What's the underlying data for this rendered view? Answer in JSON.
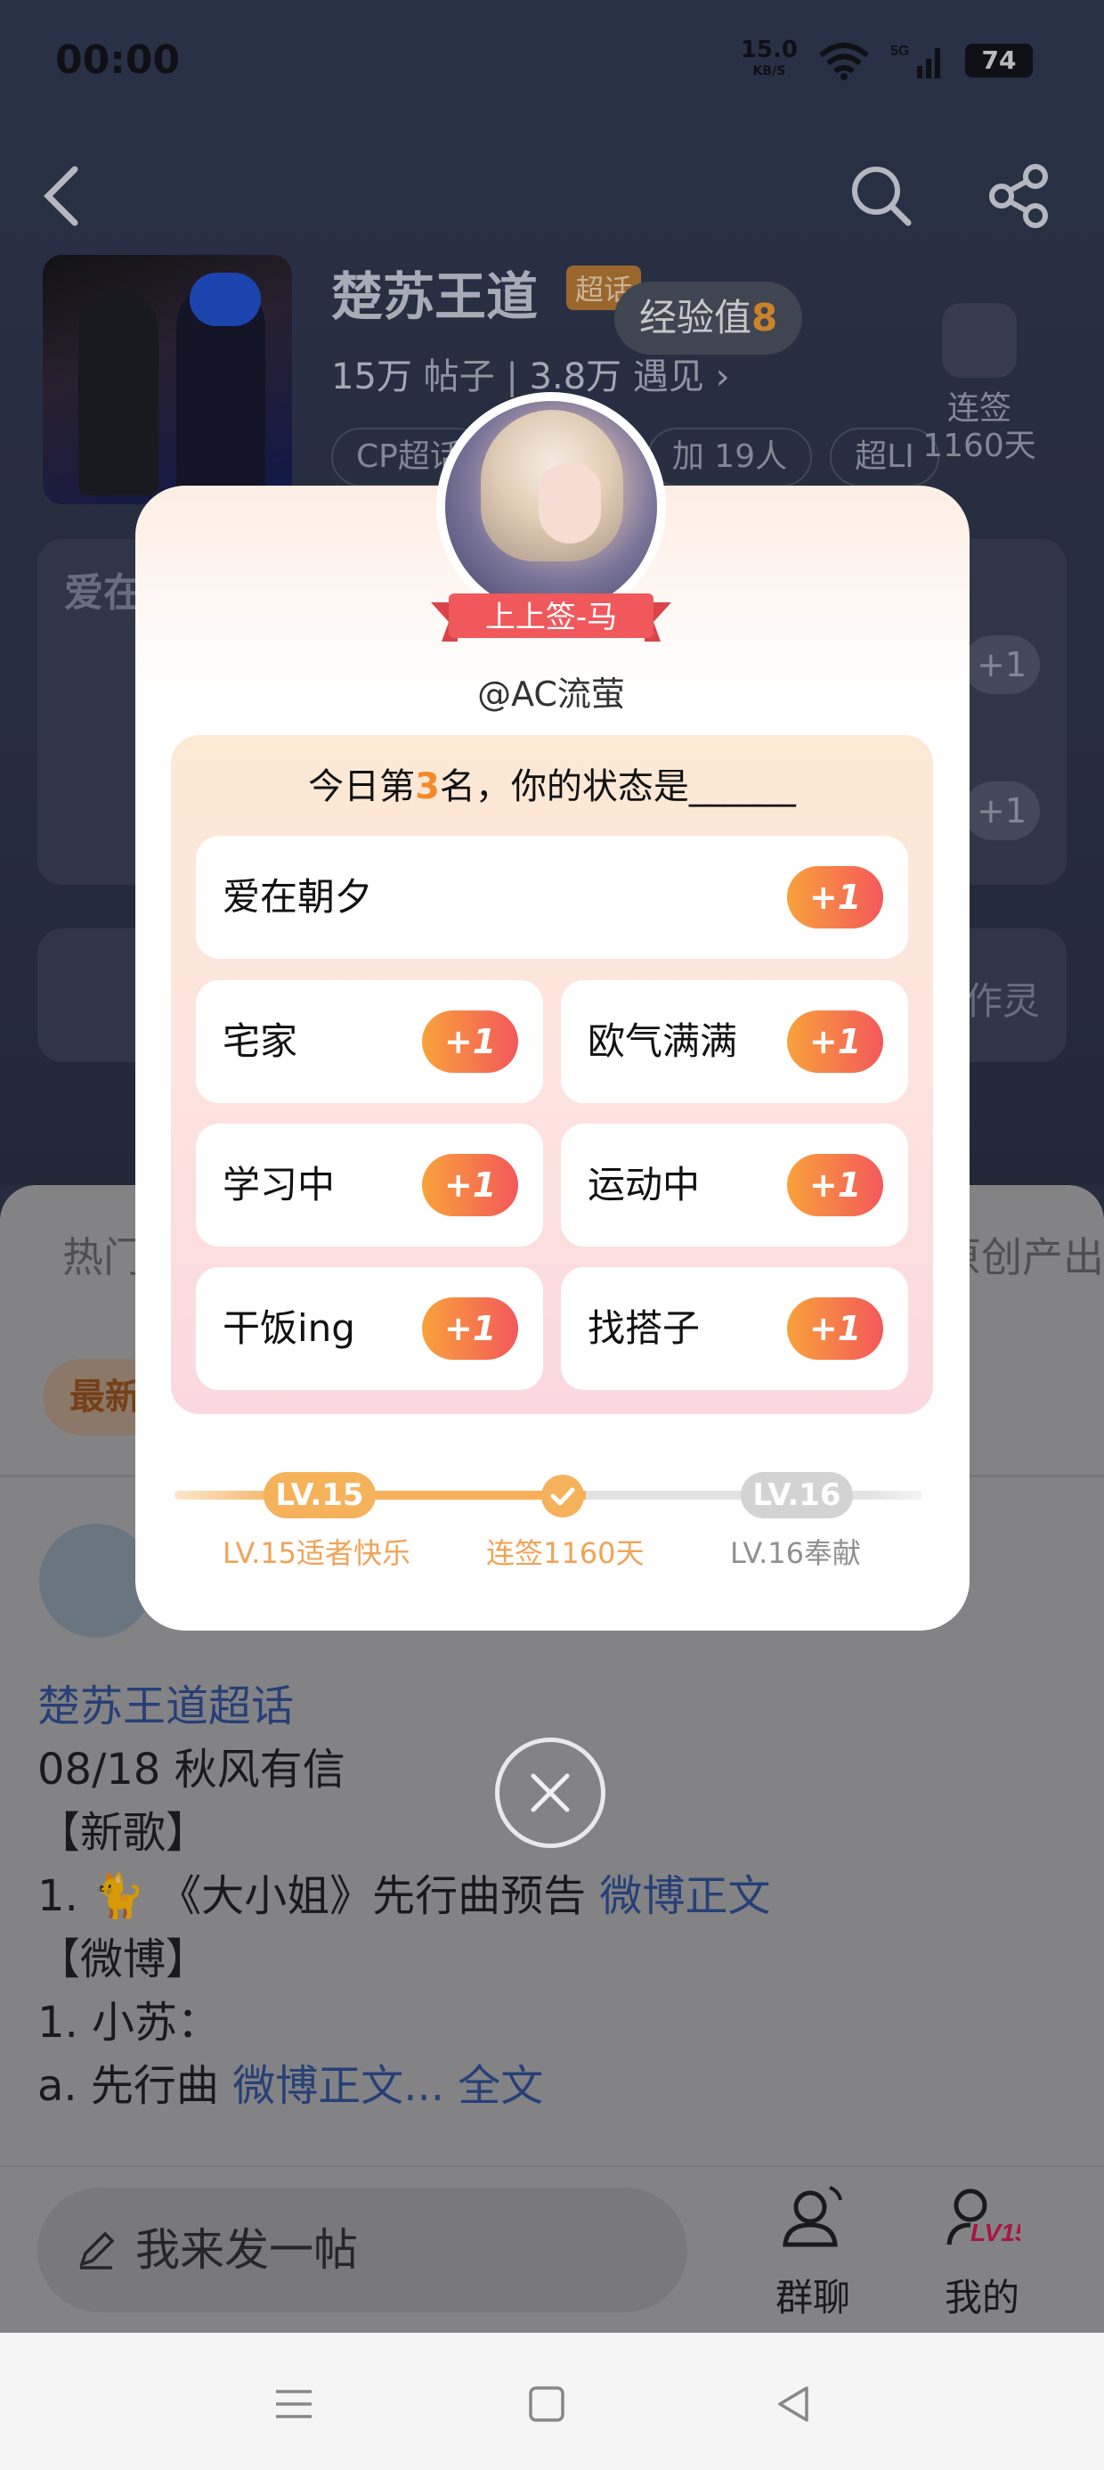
{
  "status_bar": {
    "time": "00:00",
    "speed_value": "15.0",
    "speed_unit": "KB/S",
    "battery": "74",
    "net": "5G"
  },
  "topic": {
    "title": "楚苏王道",
    "badge": "超话",
    "posts_count": "15万",
    "posts_label": "帖子",
    "meet_count": "3.8万",
    "meet_label": "遇见",
    "tags": [
      "CP超话",
      "加 19人",
      "超LI"
    ],
    "signin_label": "连签",
    "signin_days": "1160天"
  },
  "exp": {
    "label": "经验值",
    "value": "8"
  },
  "bg_cards": {
    "card_title": "爱在",
    "plus": "+1",
    "creator_text": "创作灵"
  },
  "lower": {
    "tab_left": "热门",
    "tab_right": "原创产出",
    "newest": "最新",
    "post_lines": {
      "topic_link": "楚苏王道超话",
      "l1": "08/18 秋风有信",
      "l2": "【新歌】",
      "l3_prefix": "1. 🐈 《大小姐》先行曲预告 ",
      "l3_link": "微博正文",
      "l4": "【微博】",
      "l5": "1. 小苏：",
      "l6_prefix": "a. 先行曲 ",
      "l6_link": "微博正文...",
      "l6_more": "全文"
    },
    "compose_placeholder": "我来发一帖",
    "group_chat": "群聊",
    "mine": "我的",
    "mine_level": "LV15"
  },
  "modal": {
    "ribbon": "上上签-马",
    "username": "@AC流萤",
    "question_prefix": "今日第",
    "rank": "3",
    "question_suffix": "名，你的状态是______",
    "plus": "+1",
    "options": [
      "爱在朝夕",
      "宅家",
      "欧气满满",
      "学习中",
      "运动中",
      "干饭ing",
      "找搭子"
    ],
    "level_current": "LV.15",
    "level_next": "LV.16",
    "caption_current": "LV.15适者快乐",
    "caption_mid": "连签1160天",
    "caption_next": "LV.16奉献"
  },
  "colors": {
    "accent_orange": "#f5892a",
    "plus_start": "#f9a23c",
    "plus_end": "#f3585a",
    "ribbon": "#f0585c"
  }
}
